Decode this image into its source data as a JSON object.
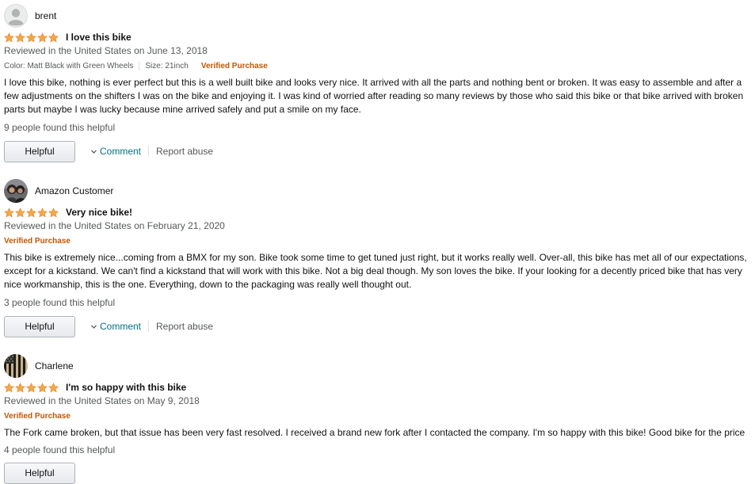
{
  "colors": {
    "star": "#f3a847",
    "verified": "#c45500",
    "link": "#007185",
    "secondary_text": "#565959"
  },
  "actions": {
    "helpful_label": "Helpful",
    "comment_label": "Comment",
    "report_label": "Report abuse"
  },
  "reviews": [
    {
      "author": "brent",
      "avatar": "default-avatar-icon",
      "rating": 5,
      "title": "I love this bike",
      "date": "Reviewed in the United States on June 13, 2018",
      "color_option": "Color: Matt Black with Green Wheels",
      "size_option": "Size: 21inch",
      "verified": "Verified Purchase",
      "body": "I love this bike, nothing is ever perfect but this is a well built bike and looks very nice. It arrived with all the parts and nothing bent or broken. It was easy to assemble and after a few adjustments on the shifters I was on the bike and enjoying it. I was kind of worried after reading so many reviews by those who said this bike or that bike arrived with broken parts but maybe I was lucky because mine arrived safely and put a smile on my face.",
      "helpful_count": "9 people found this helpful"
    },
    {
      "author": "Amazon Customer",
      "avatar": "user-photo-avatar",
      "rating": 5,
      "title": "Very nice bike!",
      "date": "Reviewed in the United States on February 21, 2020",
      "verified": "Verified Purchase",
      "body": "This bike is extremely nice...coming from a BMX for my son. Bike took some time to get tuned just right, but it works really well. Over-all, this bike has met all of our expectations, except for a kickstand. We can't find a kickstand that will work with this bike. Not a big deal though. My son loves the bike. If your looking for a decently priced bike that has very nice workmanship, this is the one. Everything, down to the packaging was really well thought out.",
      "helpful_count": "3 people found this helpful"
    },
    {
      "author": "Charlene",
      "avatar": "flag-avatar",
      "rating": 5,
      "title": "I'm so happy with this bike",
      "date": "Reviewed in the United States on May 9, 2018",
      "verified": "Verified Purchase",
      "body": "The Fork came broken, but that issue has been very fast resolved. I received a brand new fork after I contacted the company. I'm so happy with this bike! Good bike for the price",
      "helpful_count": "4 people found this helpful"
    }
  ]
}
